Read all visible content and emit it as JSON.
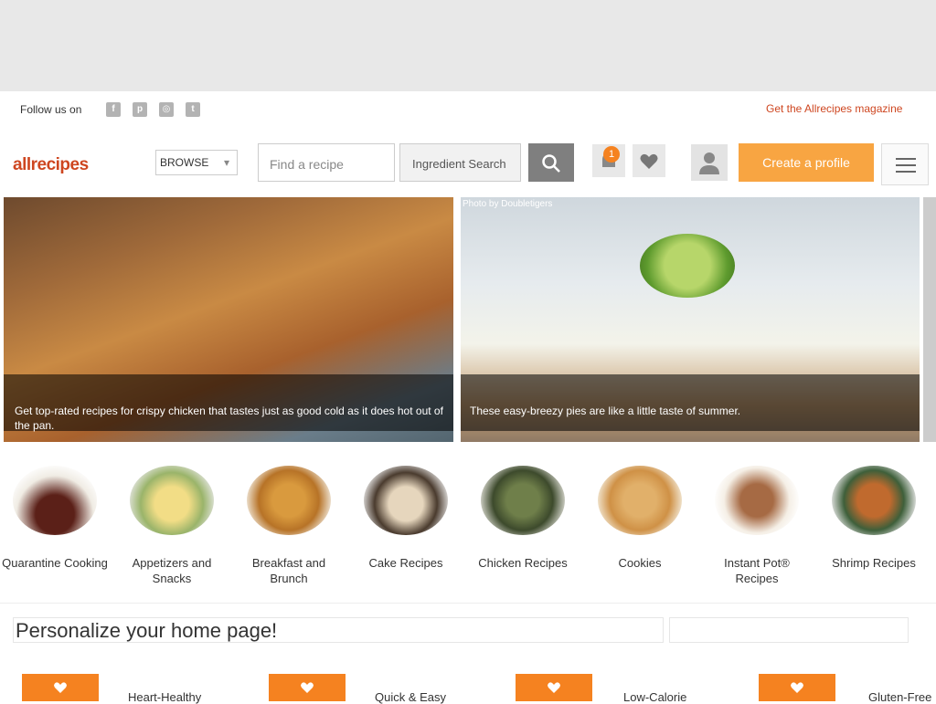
{
  "header": {
    "follow_label": "Follow us on",
    "social_icons": [
      "facebook-icon",
      "pinterest-icon",
      "instagram-icon",
      "twitter-icon"
    ],
    "magazine_link": "Get the Allrecipes magazine",
    "logo": "allrecipes",
    "browse_label": "BROWSE",
    "search_placeholder": "Find a recipe",
    "ingredient_search_label": "Ingredient Search",
    "notification_count": "1",
    "create_profile_label": "Create a profile"
  },
  "hero": {
    "photo_credit": "Photo by Doubletigers",
    "left_caption": "Get top-rated recipes for crispy chicken that tastes just as good cold as it does hot out of the pan.",
    "right_caption": "These easy-breezy pies are like a little taste of summer."
  },
  "categories": [
    {
      "label": "Quarantine Cooking",
      "color": "#6b2a1f"
    },
    {
      "label": "Appetizers and Snacks",
      "color": "#e4c76a"
    },
    {
      "label": "Breakfast and Brunch",
      "color": "#c8822e"
    },
    {
      "label": "Cake Recipes",
      "color": "#d9c4a8"
    },
    {
      "label": "Chicken Recipes",
      "color": "#7a8a5a"
    },
    {
      "label": "Cookies",
      "color": "#d8a25a"
    },
    {
      "label": "Instant Pot® Recipes",
      "color": "#a4623a"
    },
    {
      "label": "Shrimp Recipes",
      "color": "#b8642a"
    }
  ],
  "personalize": {
    "title": "Personalize your home page!"
  },
  "preferences": [
    {
      "label": "Heart-Healthy"
    },
    {
      "label": "Quick & Easy"
    },
    {
      "label": "Low-Calorie"
    },
    {
      "label": "Gluten-Free"
    }
  ],
  "colors": {
    "brand": "#ce4620",
    "accent_orange": "#f58220",
    "create_button": "#f8a542"
  }
}
